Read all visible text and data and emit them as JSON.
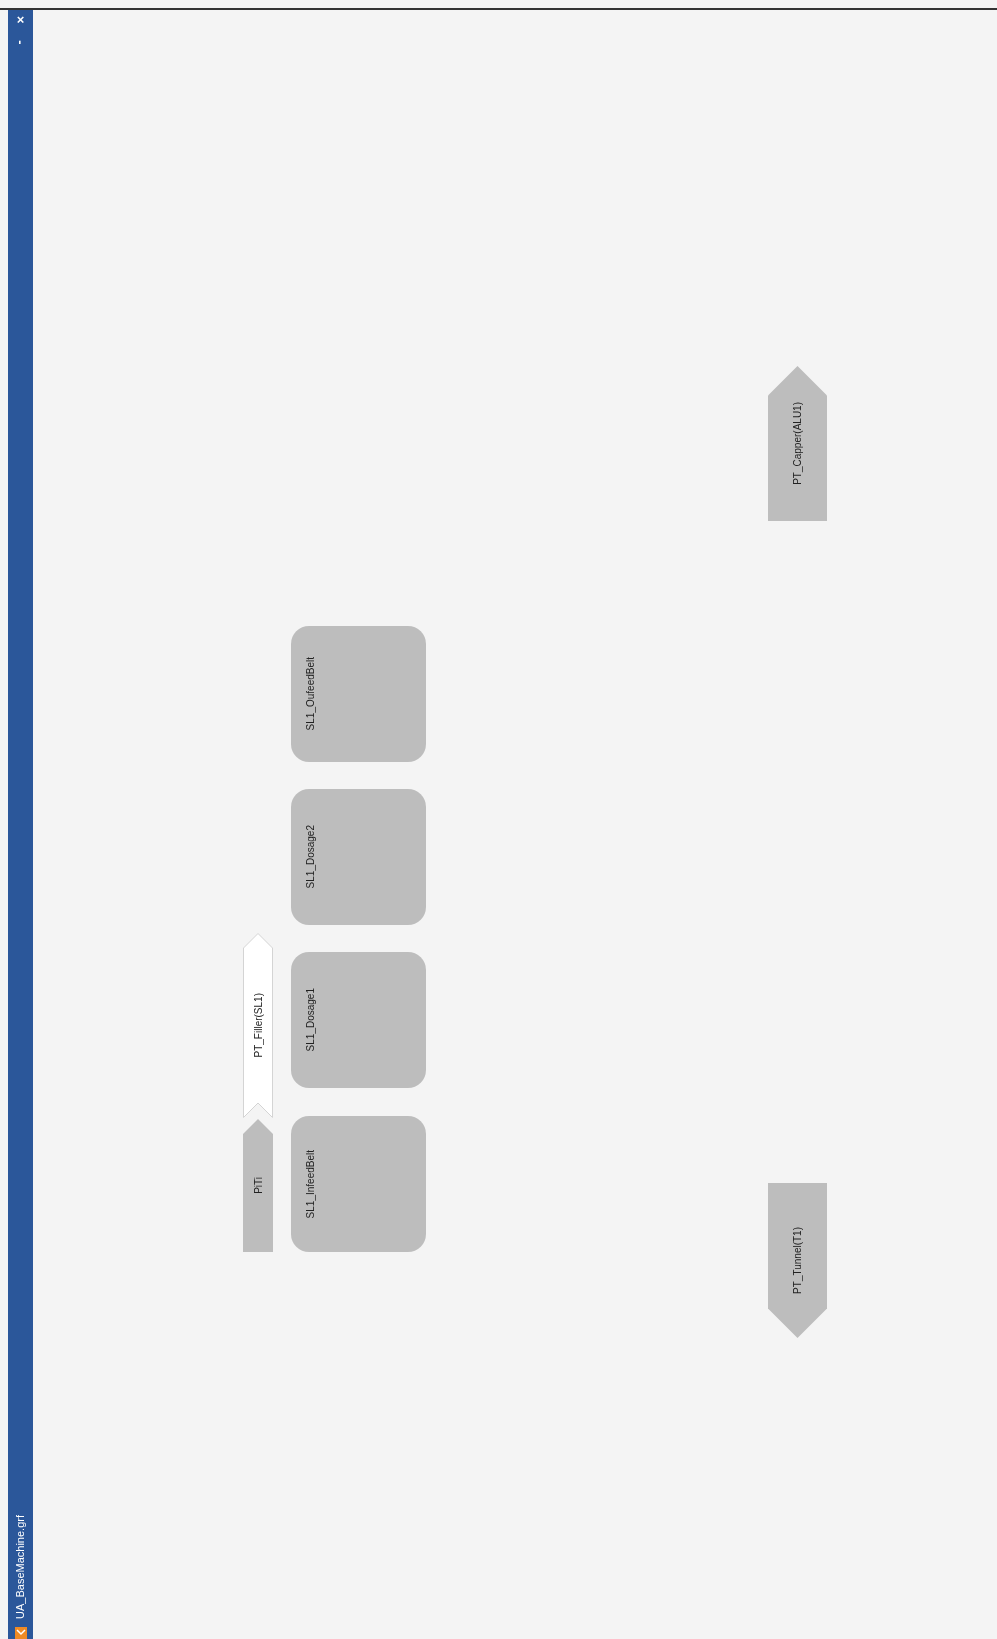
{
  "window": {
    "title": "UA_BaseMachine.grf",
    "controls": [
      "×",
      "-"
    ]
  },
  "nodes": [
    {
      "kind": "arrow_up",
      "label": "PT_Capper(ALU1)"
    },
    {
      "kind": "box",
      "label": "SL1_OufeedBelt"
    },
    {
      "kind": "box",
      "label": "SL1_Dosage2"
    },
    {
      "kind": "chevron",
      "label": "PT_Filler(SL1)"
    },
    {
      "kind": "box",
      "label": "SL1_Dosage1"
    },
    {
      "kind": "arrow_up",
      "label": "PiTi"
    },
    {
      "kind": "box",
      "label": "SL1_InfeedBelt"
    },
    {
      "kind": "arrow_down",
      "label": "PT_Tunnel(T1)"
    }
  ]
}
